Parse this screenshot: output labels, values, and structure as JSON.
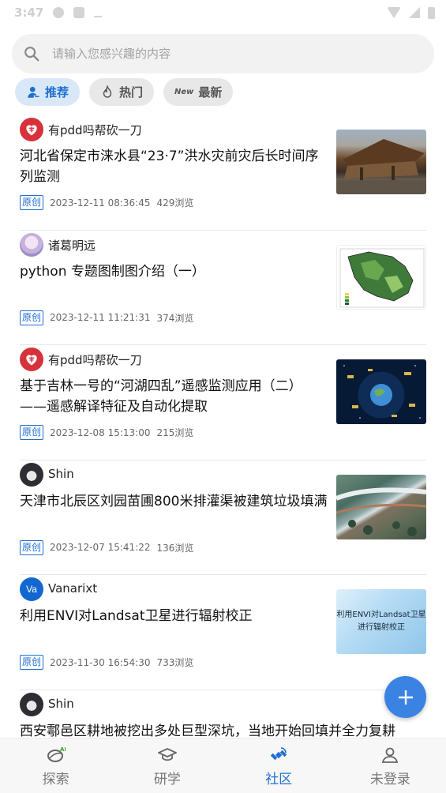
{
  "status_bar": {
    "time": "3:47"
  },
  "search": {
    "placeholder": "请输入您感兴趣的内容"
  },
  "filters": [
    {
      "label": "推荐",
      "icon": "user-icon",
      "active": true
    },
    {
      "label": "热门",
      "icon": "flame-icon",
      "active": false
    },
    {
      "label": "最新",
      "icon": "new-icon",
      "active": false
    }
  ],
  "new_glyph": "New",
  "posts": [
    {
      "author": "有pdd吗帮砍一刀",
      "title": "河北省保定市涞水县“23·7”洪水灾前灾后长时间序列监测",
      "tag": "原创",
      "date": "2023-12-11 08:36:45",
      "views": "429浏览",
      "thumb": "flood-image"
    },
    {
      "author": "诸葛明远",
      "title": "python 专题图制图介绍（一）",
      "tag": "原创",
      "date": "2023-12-11 11:21:31",
      "views": "374浏览",
      "thumb": "map-image"
    },
    {
      "author": "有pdd吗帮砍一刀",
      "title": "基于吉林一号的“河湖四乱”遥感监测应用（二）——遥感解译特征及自动化提取",
      "tag": "原创",
      "date": "2023-12-08 15:13:00",
      "views": "215浏览",
      "thumb": "satellite-space-image"
    },
    {
      "author": "Shin",
      "title": "天津市北辰区刘园苗圃800米排灌渠被建筑垃圾填满",
      "tag": "原创",
      "date": "2023-12-07 15:41:22",
      "views": "136浏览",
      "thumb": "aerial-image"
    },
    {
      "author": "Vanarixt",
      "avatar_text": "Va",
      "title": "利用ENVI对Landsat卫星进行辐射校正",
      "tag": "原创",
      "date": "2023-11-30 16:54:30",
      "views": "733浏览",
      "thumb": "envi-image",
      "thumb_text": "利用ENVI对Landsat卫星进行辐射校正"
    },
    {
      "author": "Shin",
      "title": "西安鄠邑区耕地被挖出多处巨型深坑，当地开始回填并全力复耕"
    }
  ],
  "bottom_nav": [
    {
      "label": "探索",
      "icon": "explore-ai-icon",
      "badge": "AI",
      "active": false
    },
    {
      "label": "研学",
      "icon": "graduation-cap-icon",
      "active": false
    },
    {
      "label": "社区",
      "icon": "satellite-icon",
      "active": true
    },
    {
      "label": "未登录",
      "icon": "user-outline-icon",
      "active": false
    }
  ],
  "colors": {
    "accent": "#1f6fd1",
    "fab": "#3a83e3",
    "chip_active_bg": "#d9e8f8"
  }
}
